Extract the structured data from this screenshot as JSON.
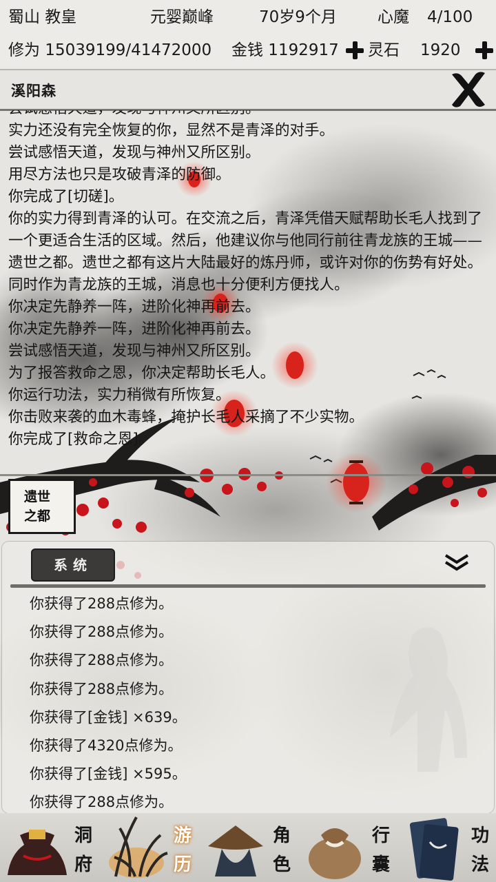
{
  "status": {
    "sect": "蜀山 教皇",
    "realm": "元婴巅峰",
    "age": "70岁9个月",
    "demon_label": "心魔",
    "demon_value": "4/100",
    "cultivation": "修为 15039199/41472000",
    "money": "金钱 1192917",
    "stone_label": "灵石",
    "stone_value": "1920"
  },
  "location": {
    "title": "溪阳森"
  },
  "story": [
    "尝试感悟天道，发现与神州又所区别。",
    "实力还没有完全恢复的你，显然不是青泽的对手。",
    "尝试感悟天道，发现与神州又所区别。",
    "用尽方法也只是攻破青泽的防御。",
    "你完成了[切磋]。",
    "你的实力得到青泽的认可。在交流之后，青泽凭借天赋帮助长毛人找到了一个更适合生活的区域。然后，他建议你与他同行前往青龙族的王城——遗世之都。遗世之都有这片大陆最好的炼丹师，或许对你的伤势有好处。同时作为青龙族的王城，消息也十分便利方便找人。",
    "你决定先静养一阵，进阶化神再前去。",
    "你决定先静养一阵，进阶化神再前去。",
    "尝试感悟天道，发现与神州又所区别。",
    "为了报答救命之恩，你决定帮助长毛人。",
    "你运行功法，实力稍微有所恢复。",
    "你击败来袭的血木毒蜂，掩护长毛人采摘了不少实物。",
    "你完成了[救命之恩]。"
  ],
  "destination": {
    "line1": "遗世",
    "line2": "之都"
  },
  "system": {
    "tab_label": "系统",
    "messages": [
      "你获得了288点修为。",
      "你获得了288点修为。",
      "你获得了288点修为。",
      "你获得了288点修为。",
      "你获得了[金钱] ×639。",
      "你获得了4320点修为。",
      "你获得了[金钱] ×595。",
      "你获得了288点修为。"
    ]
  },
  "nav": [
    {
      "c1": "洞",
      "c2": "府",
      "icon": "money-bag-icon"
    },
    {
      "c1": "游",
      "c2": "历",
      "icon": "grass-icon"
    },
    {
      "c1": "角",
      "c2": "色",
      "icon": "straw-hat-icon"
    },
    {
      "c1": "行",
      "c2": "囊",
      "icon": "bundle-icon"
    },
    {
      "c1": "功",
      "c2": "法",
      "icon": "scroll-book-icon"
    }
  ],
  "active_nav": "游历",
  "colors": {
    "lantern": "#d8221c",
    "blossom": "#c8141b",
    "ink": "#161616",
    "paper": "#ecebe8"
  }
}
